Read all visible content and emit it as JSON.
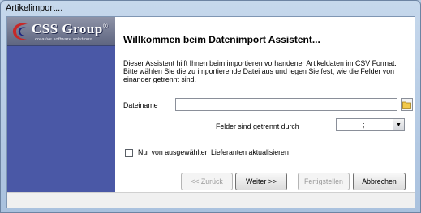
{
  "window": {
    "title": "Artikelimport..."
  },
  "logo": {
    "text": "CSS Group",
    "registered": "®",
    "tagline": "creative software solutions"
  },
  "wizard": {
    "heading": "Willkommen beim Datenimport Assistent...",
    "intro": "Dieser Assistent hilft Ihnen beim importieren vorhandener Artikeldaten im CSV Format. Bitte wählen Sie die zu importierende Datei aus und legen Sie fest, wie die Felder von einander getrennt sind."
  },
  "file": {
    "label": "Dateiname",
    "value": "",
    "browse_icon": "folder-icon"
  },
  "separator": {
    "label": "Felder sind getrennt durch",
    "value": ";"
  },
  "checkbox": {
    "label": "Nur von ausgewählten Lieferanten aktualisieren",
    "checked": false
  },
  "buttons": {
    "back": "<< Zurück",
    "next": "Weiter >>",
    "finish": "Fertigstellen",
    "cancel": "Abbrechen"
  }
}
